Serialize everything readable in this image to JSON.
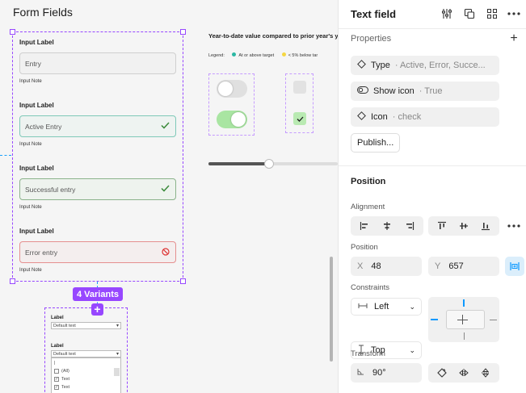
{
  "canvas": {
    "page_title": "Form Fields",
    "fields": [
      {
        "label": "Input Label",
        "value": "Entry",
        "note": "Input Note",
        "state": "default"
      },
      {
        "label": "Input Label",
        "value": "Active Entry",
        "note": "Input Note",
        "state": "active"
      },
      {
        "label": "Input Label",
        "value": "Successful entry",
        "note": "Input Note",
        "state": "success"
      },
      {
        "label": "Input Label",
        "value": "Error entry",
        "note": "Input Note",
        "state": "error"
      }
    ],
    "variants_badge": "4 Variants",
    "dropdown": {
      "label1": "Label",
      "select1": "Default text",
      "label2": "Label",
      "select2": "Default text",
      "search_value": "|",
      "items": [
        "(All)",
        "Text",
        "Text"
      ]
    },
    "legend": {
      "heading": "Year-to-date value compared to prior year's ye",
      "prefix": "Legend:",
      "item1": "At or above target",
      "item2": "< 5% below tar",
      "color1": "#2bb7a3",
      "color2": "#f5d742"
    },
    "toggle_on_color": "#a9e5a2",
    "slider_value_percent": 47
  },
  "panel": {
    "title": "Text field",
    "properties_title": "Properties",
    "props": [
      {
        "icon": "diamond-icon",
        "name": "Type",
        "value": "· Active, Error, Succe..."
      },
      {
        "icon": "toggle-icon",
        "name": "Show icon",
        "value": "· True"
      },
      {
        "icon": "diamond-icon",
        "name": "Icon",
        "value": "· check"
      }
    ],
    "publish_label": "Publish...",
    "position_title": "Position",
    "alignment_label": "Alignment",
    "position_label": "Position",
    "x_label": "X",
    "x_value": "48",
    "y_label": "Y",
    "y_value": "657",
    "constraints_label": "Constraints",
    "h_constraint": "Left",
    "v_constraint": "Top",
    "transform_label": "Transform",
    "rotation_value": "90°"
  }
}
